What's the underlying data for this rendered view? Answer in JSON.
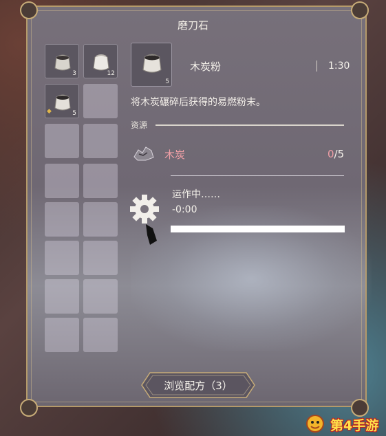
{
  "panel": {
    "title": "磨刀石"
  },
  "inventory": {
    "slots": [
      {
        "count": "3",
        "highlight": false
      },
      {
        "count": "12",
        "highlight": false
      },
      {
        "count": "5",
        "highlight": true
      }
    ]
  },
  "item": {
    "name": "木炭粉",
    "count": "5",
    "craft_time": "1:30",
    "description": "将木炭碾碎后获得的易燃粉末。"
  },
  "resources": {
    "label": "资源",
    "items": [
      {
        "name": "木炭",
        "have": "0",
        "need": "/5"
      }
    ]
  },
  "progress": {
    "status": "运作中……",
    "timer": "-0:00",
    "fraction": 1.0
  },
  "browse_button": {
    "label": "浏览配方（3）"
  },
  "watermark": {
    "text": "第4手游"
  },
  "colors": {
    "accent_gold": "#b59a6a",
    "resource_pink": "#ef9fa6",
    "text_light": "#f4f1ea"
  }
}
